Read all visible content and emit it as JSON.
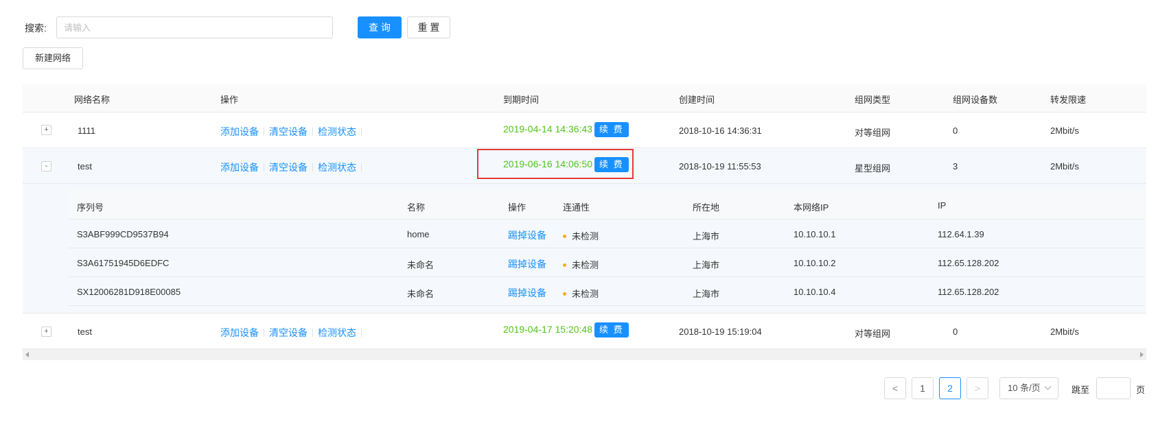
{
  "search": {
    "label": "搜索:",
    "placeholder": "请输入",
    "value": ""
  },
  "buttons": {
    "query": "查 询",
    "reset": "重 置",
    "new_network": "新建网络"
  },
  "table": {
    "headers": [
      "网络名称",
      "操作",
      "到期时间",
      "创建时间",
      "组网类型",
      "组网设备数",
      "转发限速"
    ],
    "rows": [
      {
        "expander": "+",
        "name": "1111",
        "ops": [
          "添加设备",
          "清空设备",
          "检测状态"
        ],
        "expire": "2019-04-14 14:36:43",
        "renew": "续 费",
        "created": "2018-10-16 14:36:31",
        "type": "对等组网",
        "count": "0",
        "rate": "2Mbit/s"
      },
      {
        "expander": "-",
        "name": "test",
        "ops": [
          "添加设备",
          "清空设备",
          "检测状态"
        ],
        "expire": "2019-06-16 14:06:50",
        "renew": "续 费",
        "created": "2018-10-19 11:55:53",
        "type": "星型组网",
        "count": "3",
        "rate": "2Mbit/s"
      },
      {
        "expander": "+",
        "name": "test",
        "ops": [
          "添加设备",
          "清空设备",
          "检测状态"
        ],
        "expire": "2019-04-17 15:20:48",
        "renew": "续 费",
        "created": "2018-10-19 15:19:04",
        "type": "对等组网",
        "count": "0",
        "rate": "2Mbit/s"
      }
    ],
    "sub": {
      "headers": [
        "序列号",
        "名称",
        "操作",
        "连通性",
        "所在地",
        "本网络IP",
        "IP"
      ],
      "rows": [
        {
          "serial": "S3ABF999CD9537B94",
          "name": "home",
          "op": "踢掉设备",
          "status": "未检测",
          "location": "上海市",
          "net_ip": "10.10.10.1",
          "ip": "112.64.1.39"
        },
        {
          "serial": "S3A61751945D6EDFC",
          "name": "未命名",
          "op": "踢掉设备",
          "status": "未检测",
          "location": "上海市",
          "net_ip": "10.10.10.2",
          "ip": "112.65.128.202"
        },
        {
          "serial": "SX12006281D918E00085",
          "name": "未命名",
          "op": "踢掉设备",
          "status": "未检测",
          "location": "上海市",
          "net_ip": "10.10.10.4",
          "ip": "112.65.128.202"
        }
      ]
    }
  },
  "pagination": {
    "prev": "<",
    "pages": [
      "1",
      "2"
    ],
    "current": "2",
    "next": ">",
    "page_size": "10 条/页",
    "jump_label": "跳至",
    "jump_suffix": "页",
    "jump_value": ""
  },
  "colors": {
    "primary": "#1890ff",
    "expire_green": "#52c41a",
    "status_dot": "#faad14",
    "highlight_border": "#e53935"
  }
}
